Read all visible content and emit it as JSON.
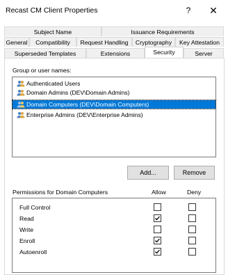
{
  "window": {
    "title": "Recast CM Client Properties",
    "help_glyph": "?",
    "close_glyph": "✕"
  },
  "tabs": {
    "row1": [
      "Subject Name",
      "Issuance Requirements"
    ],
    "row2": [
      "General",
      "Compatibility",
      "Request Handling",
      "Cryptography",
      "Key Attestation"
    ],
    "row3": [
      "Superseded Templates",
      "Extensions",
      "Security",
      "Server"
    ],
    "active": "Security"
  },
  "group_section": {
    "label": "Group or user names:",
    "items": [
      {
        "name": "Authenticated Users",
        "selected": false
      },
      {
        "name": "Domain Admins (DEV\\Domain Admins)",
        "selected": false
      },
      {
        "name": "Domain Computers (DEV\\Domain Computers)",
        "selected": true
      },
      {
        "name": "Enterprise Admins (DEV\\Enterprise Admins)",
        "selected": false
      }
    ],
    "add_label": "Add...",
    "remove_label": "Remove"
  },
  "permissions": {
    "header": "Permissions for Domain Computers",
    "allow_header": "Allow",
    "deny_header": "Deny",
    "rows": [
      {
        "name": "Full Control",
        "allow": false,
        "deny": false
      },
      {
        "name": "Read",
        "allow": true,
        "deny": false
      },
      {
        "name": "Write",
        "allow": false,
        "deny": false
      },
      {
        "name": "Enroll",
        "allow": true,
        "deny": false
      },
      {
        "name": "Autoenroll",
        "allow": true,
        "deny": false
      }
    ]
  },
  "colors": {
    "selection": "#0078d7",
    "button": "#e1e1e1"
  }
}
